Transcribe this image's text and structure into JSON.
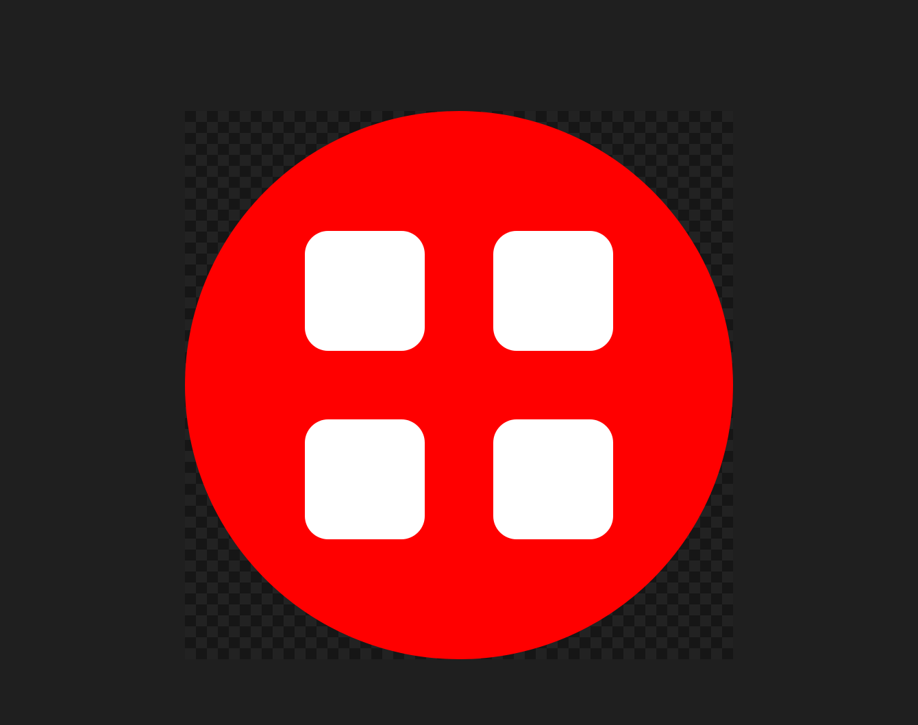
{
  "image": {
    "icon_name": "apps-grid-circle-icon",
    "colors": {
      "background": "#1f1f1f",
      "checker_dark": "#161616",
      "checker_light": "#222222",
      "circle": "#ff0000",
      "tiles": "#ffffff"
    }
  }
}
